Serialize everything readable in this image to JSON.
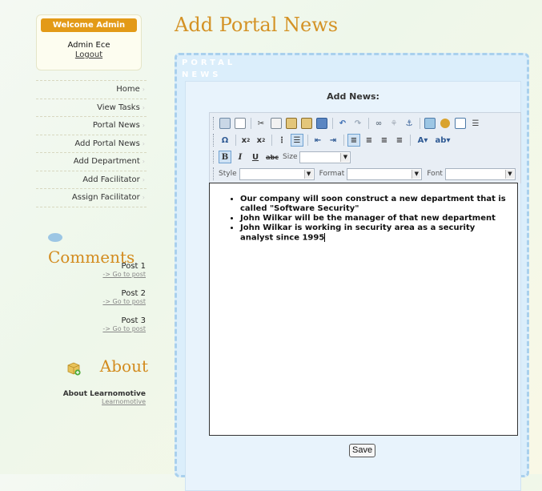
{
  "sidebar": {
    "welcome_badge": "Welcome Admin",
    "admin_name": "Admin Ece",
    "logout": "Logout",
    "nav": [
      "Home",
      "View Tasks",
      "Portal News",
      "Add Portal News",
      "Add Department",
      "Add Facilitator",
      "Assign Facilitator"
    ],
    "comments_title": "Comments",
    "posts": [
      {
        "title": "Post 1",
        "link": "-> Go to post"
      },
      {
        "title": "Post 2",
        "link": "-> Go to post"
      },
      {
        "title": "Post 3",
        "link": "-> Go to post"
      }
    ],
    "about_title": "About",
    "about_heading": "About Learnomotive",
    "about_link": "Learnomotive"
  },
  "main": {
    "page_title": "Add Portal News",
    "panel_label": "PORTAL NEWS",
    "form_heading": "Add News:",
    "toolbar": {
      "size_label": "Size",
      "style_label": "Style",
      "format_label": "Format",
      "font_label": "Font",
      "size_value": "",
      "style_value": "",
      "format_value": "",
      "font_value": ""
    },
    "editor_items": [
      "Our company will soon construct a new department that is called \"Software Security\"",
      "John Wilkar will be the manager of that new department",
      "John Wilkar is working in security area as a security analyst since 1995"
    ],
    "save_label": "Save"
  },
  "colors": {
    "accent_orange": "#e39a17",
    "title_orange": "#d49225",
    "panel_blue": "#dbeefb",
    "panel_border": "#a9d0ed"
  }
}
